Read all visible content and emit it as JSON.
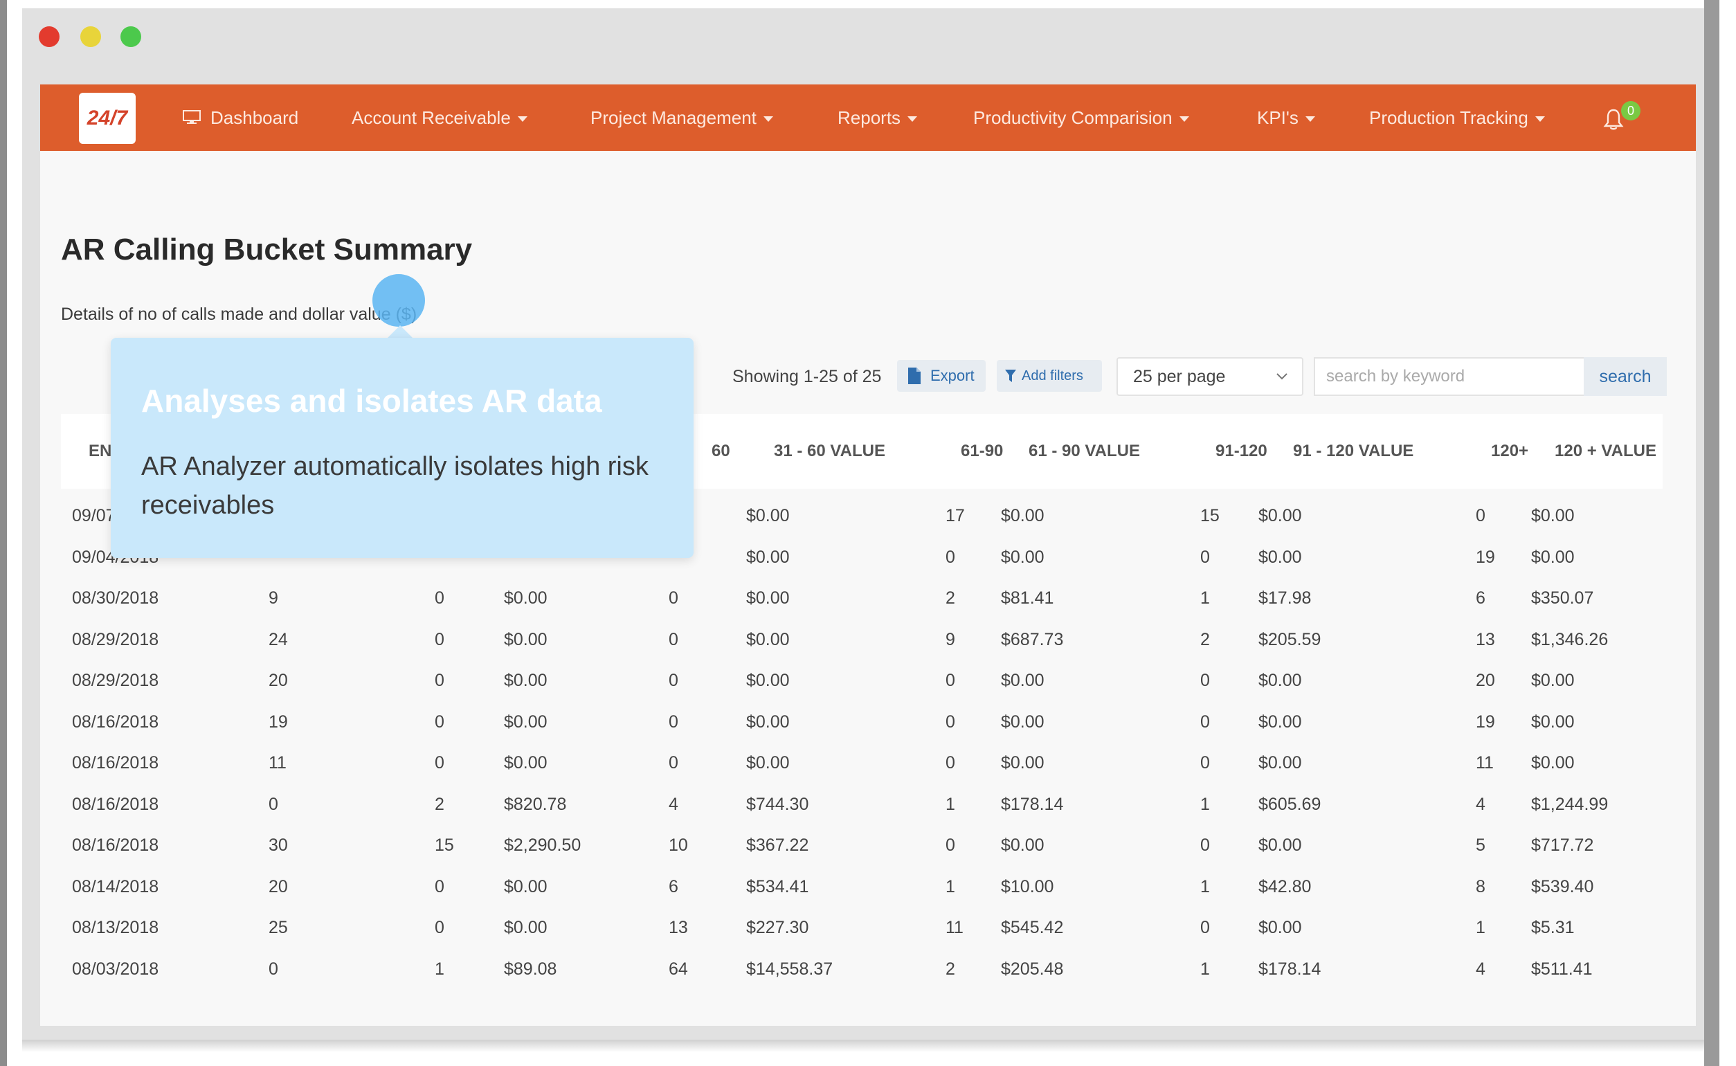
{
  "window": {
    "title": ""
  },
  "navbar": {
    "logo_text": "24/7",
    "items": [
      {
        "label": "Dashboard",
        "has_caret": false
      },
      {
        "label": "Account Receivable",
        "has_caret": true
      },
      {
        "label": "Project Management",
        "has_caret": true
      },
      {
        "label": "Reports",
        "has_caret": true
      },
      {
        "label": "Productivity Comparision",
        "has_caret": true
      },
      {
        "label": "KPI's",
        "has_caret": true
      },
      {
        "label": "Production Tracking",
        "has_caret": true
      }
    ],
    "notification_count": "0",
    "accent_color": "#dd5d2c"
  },
  "page": {
    "title": "AR Calling Bucket Summary",
    "subtitle": "Details of no of calls made and dollar value ($)"
  },
  "toolbar": {
    "showing": "Showing 1-25 of 25",
    "export_label": "Export",
    "filter_label": "Add filters",
    "per_page": "25 per page",
    "search_placeholder": "search by keyword",
    "search_label": "search"
  },
  "table": {
    "headers": [
      "EN",
      "60",
      "31 - 60 VALUE",
      "61-90",
      "61 - 90 VALUE",
      "91-120",
      "91 - 120 VALUE",
      "120+",
      "120 + VALUE"
    ],
    "rows": [
      [
        "09/07",
        "",
        "",
        "",
        "",
        "$0.00",
        "17",
        "$0.00",
        "15",
        "$0.00",
        "0",
        "$0.00"
      ],
      [
        "09/04/2018",
        "",
        "",
        "",
        "",
        "$0.00",
        "0",
        "$0.00",
        "0",
        "$0.00",
        "19",
        "$0.00"
      ],
      [
        "08/30/2018",
        "9",
        "0",
        "$0.00",
        "0",
        "$0.00",
        "2",
        "$81.41",
        "1",
        "$17.98",
        "6",
        "$350.07"
      ],
      [
        "08/29/2018",
        "24",
        "0",
        "$0.00",
        "0",
        "$0.00",
        "9",
        "$687.73",
        "2",
        "$205.59",
        "13",
        "$1,346.26"
      ],
      [
        "08/29/2018",
        "20",
        "0",
        "$0.00",
        "0",
        "$0.00",
        "0",
        "$0.00",
        "0",
        "$0.00",
        "20",
        "$0.00"
      ],
      [
        "08/16/2018",
        "19",
        "0",
        "$0.00",
        "0",
        "$0.00",
        "0",
        "$0.00",
        "0",
        "$0.00",
        "19",
        "$0.00"
      ],
      [
        "08/16/2018",
        "11",
        "0",
        "$0.00",
        "0",
        "$0.00",
        "0",
        "$0.00",
        "0",
        "$0.00",
        "11",
        "$0.00"
      ],
      [
        "08/16/2018",
        "0",
        "2",
        "$820.78",
        "4",
        "$744.30",
        "1",
        "$178.14",
        "1",
        "$605.69",
        "4",
        "$1,244.99"
      ],
      [
        "08/16/2018",
        "30",
        "15",
        "$2,290.50",
        "10",
        "$367.22",
        "0",
        "$0.00",
        "0",
        "$0.00",
        "5",
        "$717.72"
      ],
      [
        "08/14/2018",
        "20",
        "0",
        "$0.00",
        "6",
        "$534.41",
        "1",
        "$10.00",
        "1",
        "$42.80",
        "8",
        "$539.40"
      ],
      [
        "08/13/2018",
        "25",
        "0",
        "$0.00",
        "13",
        "$227.30",
        "11",
        "$545.42",
        "0",
        "$0.00",
        "1",
        "$5.31"
      ],
      [
        "08/03/2018",
        "0",
        "1",
        "$89.08",
        "64",
        "$14,558.37",
        "2",
        "$205.48",
        "1",
        "$178.14",
        "4",
        "$511.41"
      ]
    ]
  },
  "tooltip": {
    "title": "Analyses and isolates AR data",
    "body": "AR Analyzer automatically isolates high risk receivables"
  }
}
